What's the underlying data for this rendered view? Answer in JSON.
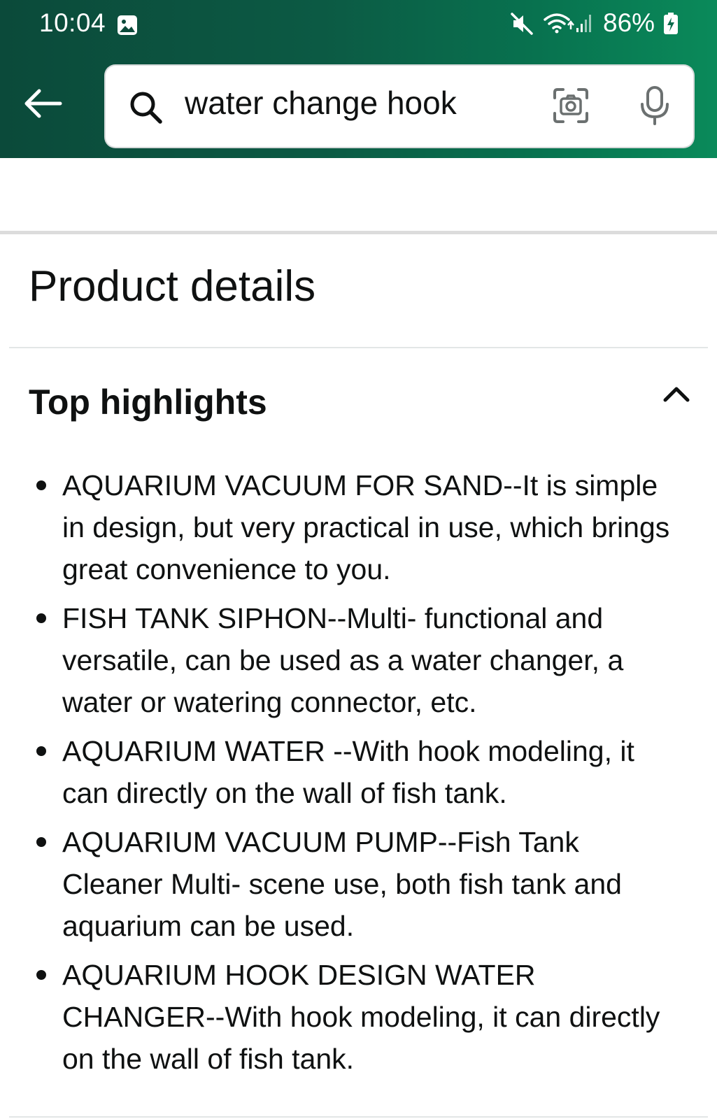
{
  "status_bar": {
    "time": "10:04",
    "battery": "86%",
    "icons": [
      "gallery-icon",
      "mute-icon",
      "wifi-icon",
      "signal-icon",
      "battery-icon"
    ]
  },
  "header": {
    "background_start": "#0b4a3a",
    "background_end": "#0a8a5a",
    "back_icon": "arrow-left-icon",
    "search": {
      "value": "water change hook",
      "icons": [
        "search-icon",
        "camera-icon",
        "mic-icon"
      ]
    }
  },
  "product_details": {
    "title": "Product details",
    "section": {
      "title": "Top highlights",
      "expanded": true,
      "toggle_icon": "chevron-up-icon",
      "items": [
        "AQUARIUM VACUUM FOR SAND--It is simple in design, but very practical in use, which brings great convenience to you.",
        "FISH TANK SIPHON--Multi- functional and versatile, can be used as a water changer, a water or watering connector, etc.",
        "AQUARIUM WATER --With hook modeling, it can directly on the wall of fish tank.",
        "AQUARIUM VACUUM PUMP--Fish Tank Cleaner Multi- scene use, both fish tank and aquarium can be used.",
        "AQUARIUM HOOK DESIGN WATER CHANGER--With hook modeling, it can directly on the wall of fish tank."
      ]
    }
  }
}
